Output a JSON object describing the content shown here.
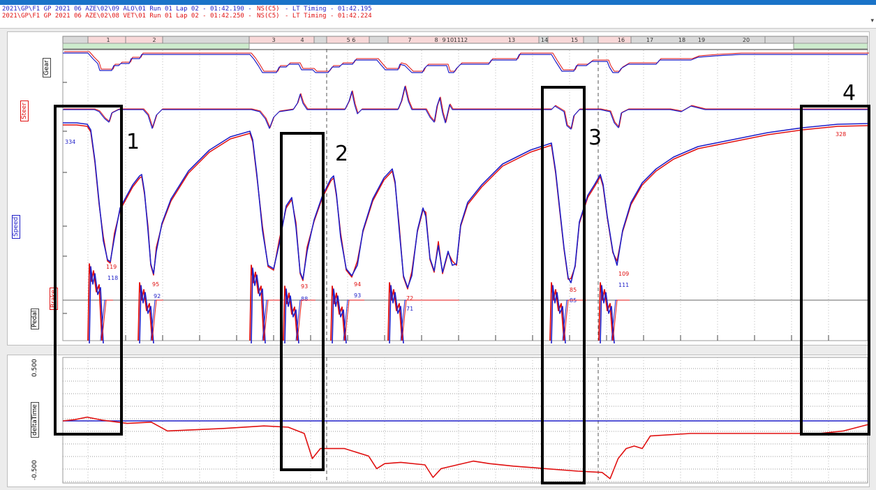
{
  "header": {
    "lap_a": {
      "session": "2021\\GP\\F1  GP  2021  06  AZE\\02\\09  ALO\\01  Run  01  Lap  02 - 01:42.190 -",
      "ns": "NS(C5)",
      "timing": "- LT Timing - 01:42.195"
    },
    "lap_b": {
      "session": "2021\\GP\\F1  GP  2021  06  AZE\\02\\08  VET\\01  Run  01  Lap  02 - 01:42.250 -",
      "ns": "NS(C5)",
      "timing": "- LT Timing - 01:42.224"
    },
    "colors": {
      "lap_a": "#1f1fc8",
      "lap_b": "#e01010"
    }
  },
  "channels": {
    "gear": "Gear",
    "steer": "Steer",
    "speed": "Speed",
    "brake": "Brake",
    "pedal": "Pedal",
    "delta": "deltaTime"
  },
  "annotations": [
    "1",
    "2",
    "3",
    "4"
  ],
  "chart_data": {
    "type": "line",
    "corners": [
      "1",
      "2",
      "3",
      "4",
      "5 6",
      "7",
      "8",
      "9",
      "10",
      "11",
      "12",
      "13",
      "14",
      "15",
      "16",
      "17",
      "18",
      "19",
      "20"
    ],
    "series": [
      {
        "name": "ALO",
        "color": "#1f1fc8"
      },
      {
        "name": "VET",
        "color": "#e01010"
      }
    ],
    "speed_labels": [
      {
        "lap": "ALO",
        "value": "334"
      },
      {
        "lap": "VET",
        "value": "119"
      },
      {
        "lap": "ALO",
        "value": "118"
      },
      {
        "lap": "VET",
        "value": "95"
      },
      {
        "lap": "ALO",
        "value": "92"
      },
      {
        "lap": "VET",
        "value": "93"
      },
      {
        "lap": "ALO",
        "value": "88"
      },
      {
        "lap": "VET",
        "value": "94"
      },
      {
        "lap": "ALO",
        "value": "93"
      },
      {
        "lap": "VET",
        "value": "72"
      },
      {
        "lap": "ALO",
        "value": "71"
      },
      {
        "lap": "VET",
        "value": "85"
      },
      {
        "lap": "ALO",
        "value": "85"
      },
      {
        "lap": "VET",
        "value": "109"
      },
      {
        "lap": "ALO",
        "value": "111"
      },
      {
        "lap": "VET",
        "value": "328"
      }
    ],
    "delta_axis": {
      "ticks": [
        "0.500",
        "-0.500"
      ],
      "ylim": [
        -0.5,
        0.5
      ]
    },
    "delta_time": {
      "ALO": [
        [
          0,
          0
        ],
        [
          1,
          0
        ]
      ],
      "VET": [
        [
          0,
          0
        ],
        [
          0.015,
          0.01
        ],
        [
          0.03,
          0.03
        ],
        [
          0.05,
          0.005
        ],
        [
          0.08,
          -0.02
        ],
        [
          0.11,
          -0.01
        ],
        [
          0.13,
          -0.08
        ],
        [
          0.2,
          -0.06
        ],
        [
          0.25,
          -0.04
        ],
        [
          0.28,
          -0.05
        ],
        [
          0.3,
          -0.1
        ],
        [
          0.31,
          -0.3
        ],
        [
          0.32,
          -0.22
        ],
        [
          0.35,
          -0.22
        ],
        [
          0.38,
          -0.28
        ],
        [
          0.39,
          -0.38
        ],
        [
          0.4,
          -0.34
        ],
        [
          0.42,
          -0.33
        ],
        [
          0.45,
          -0.35
        ],
        [
          0.46,
          -0.45
        ],
        [
          0.47,
          -0.38
        ],
        [
          0.49,
          -0.35
        ],
        [
          0.51,
          -0.32
        ],
        [
          0.53,
          -0.34
        ],
        [
          0.56,
          -0.36
        ],
        [
          0.6,
          -0.38
        ],
        [
          0.64,
          -0.4
        ],
        [
          0.67,
          -0.41
        ],
        [
          0.68,
          -0.46
        ],
        [
          0.69,
          -0.3
        ],
        [
          0.7,
          -0.22
        ],
        [
          0.71,
          -0.2
        ],
        [
          0.72,
          -0.22
        ],
        [
          0.73,
          -0.12
        ],
        [
          0.78,
          -0.1
        ],
        [
          0.83,
          -0.1
        ],
        [
          0.86,
          -0.1
        ],
        [
          0.9,
          -0.1
        ],
        [
          0.94,
          -0.1
        ],
        [
          0.97,
          -0.08
        ],
        [
          1.0,
          -0.03
        ]
      ]
    }
  }
}
